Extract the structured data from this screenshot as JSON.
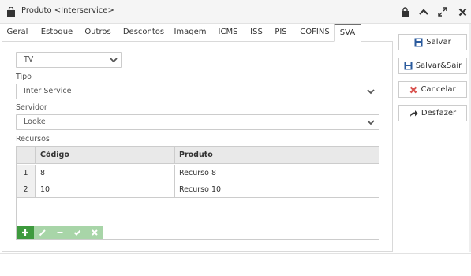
{
  "window": {
    "title": "Produto <Interservice>"
  },
  "tabs": [
    {
      "label": "Geral"
    },
    {
      "label": "Estoque"
    },
    {
      "label": "Outros"
    },
    {
      "label": "Descontos"
    },
    {
      "label": "Imagem"
    },
    {
      "label": "ICMS"
    },
    {
      "label": "ISS"
    },
    {
      "label": "PIS"
    },
    {
      "label": "COFINS"
    },
    {
      "label": "SVA"
    }
  ],
  "active_tab": "SVA",
  "form": {
    "category_select": {
      "value": "TV"
    },
    "tipo": {
      "label": "Tipo",
      "value": "Inter Service"
    },
    "servidor": {
      "label": "Servidor",
      "value": "Looke"
    },
    "recursos": {
      "label": "Recursos",
      "columns": [
        "Código",
        "Produto"
      ],
      "rows": [
        {
          "num": "1",
          "codigo": "8",
          "produto": "Recurso 8"
        },
        {
          "num": "2",
          "codigo": "10",
          "produto": "Recurso 10"
        }
      ],
      "toolbar": [
        "plus-icon",
        "pencil-icon",
        "minus-icon",
        "check-icon",
        "x-icon"
      ]
    }
  },
  "actions": {
    "salvar": "Salvar",
    "salvar_sair": "Salvar&Sair",
    "cancelar": "Cancelar",
    "desfazer": "Desfazer"
  },
  "colors": {
    "accent_green": "#5cb85c",
    "cancel_red": "#d9534f",
    "save_blue": "#2a5a9c"
  }
}
